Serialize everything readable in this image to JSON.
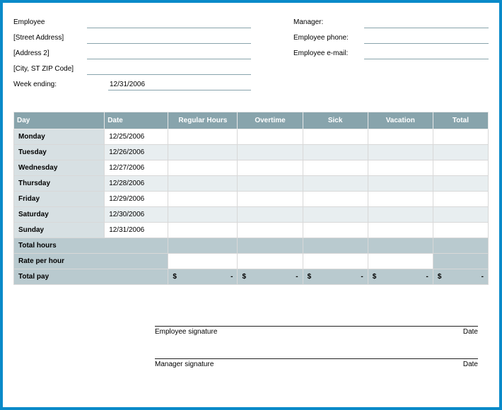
{
  "header": {
    "left": {
      "employee": "Employee",
      "street": "[Street Address]",
      "address2": "[Address 2]",
      "cityzip": "[City, ST  ZIP Code]",
      "week_ending_label": "Week ending:",
      "week_ending_value": "12/31/2006"
    },
    "right": {
      "manager": "Manager:",
      "emp_phone": "Employee phone:",
      "emp_email": "Employee e-mail:"
    }
  },
  "table": {
    "headers": {
      "day": "Day",
      "date": "Date",
      "regular": "Regular Hours",
      "overtime": "Overtime",
      "sick": "Sick",
      "vacation": "Vacation",
      "total": "Total"
    },
    "rows": [
      {
        "day": "Monday",
        "date": "12/25/2006"
      },
      {
        "day": "Tuesday",
        "date": "12/26/2006"
      },
      {
        "day": "Wednesday",
        "date": "12/27/2006"
      },
      {
        "day": "Thursday",
        "date": "12/28/2006"
      },
      {
        "day": "Friday",
        "date": "12/29/2006"
      },
      {
        "day": "Saturday",
        "date": "12/30/2006"
      },
      {
        "day": "Sunday",
        "date": "12/31/2006"
      }
    ],
    "total_hours_label": "Total hours",
    "rate_label": "Rate per hour",
    "total_pay_label": "Total pay",
    "dollar": "$",
    "dash": "-"
  },
  "signatures": {
    "employee": "Employee signature",
    "manager": "Manager signature",
    "date": "Date"
  }
}
